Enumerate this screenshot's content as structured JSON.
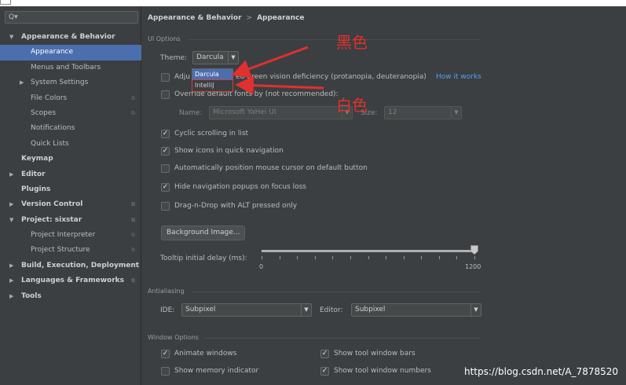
{
  "sidebar": {
    "search_placeholder": "Q▾",
    "items": [
      {
        "label": "Appearance & Behavior",
        "level": 0,
        "bold": true,
        "arrow": "▼"
      },
      {
        "label": "Appearance",
        "level": 1,
        "selected": true
      },
      {
        "label": "Menus and Toolbars",
        "level": 1
      },
      {
        "label": "System Settings",
        "level": 1,
        "arrow": "▶"
      },
      {
        "label": "File Colors",
        "level": 1,
        "copy": true
      },
      {
        "label": "Scopes",
        "level": 1,
        "copy": true
      },
      {
        "label": "Notifications",
        "level": 1
      },
      {
        "label": "Quick Lists",
        "level": 1
      },
      {
        "label": "Keymap",
        "level": 0,
        "bold": true
      },
      {
        "label": "Editor",
        "level": 0,
        "bold": true,
        "arrow": "▶"
      },
      {
        "label": "Plugins",
        "level": 0,
        "bold": true
      },
      {
        "label": "Version Control",
        "level": 0,
        "bold": true,
        "arrow": "▶",
        "copy": true
      },
      {
        "label": "Project: sixstar",
        "level": 0,
        "bold": true,
        "arrow": "▼",
        "copy": true
      },
      {
        "label": "Project Interpreter",
        "level": 1,
        "copy": true
      },
      {
        "label": "Project Structure",
        "level": 1,
        "copy": true
      },
      {
        "label": "Build, Execution, Deployment",
        "level": 0,
        "bold": true,
        "arrow": "▶"
      },
      {
        "label": "Languages & Frameworks",
        "level": 0,
        "bold": true,
        "arrow": "▶",
        "copy": true
      },
      {
        "label": "Tools",
        "level": 0,
        "bold": true,
        "arrow": "▶"
      }
    ]
  },
  "breadcrumb": {
    "part1": "Appearance & Behavior",
    "separator": ">",
    "part2": "Appearance"
  },
  "ui_options": {
    "title": "UI Options",
    "theme_label": "Theme:",
    "theme_value": "Darcula",
    "theme_options": [
      "Darcula",
      "IntelliJ"
    ],
    "adjust_label": "Adju",
    "adjust_rest": "ed-green vision deficiency (protanopia, deuteranopia)",
    "how_it_works": "How it works",
    "override_label": "Override default fonts by (not recommended):",
    "name_label": "Name:",
    "name_value": "Microsoft YaHei UI",
    "size_label": "Size:",
    "size_value": "12",
    "checkboxes": [
      {
        "label": "Cyclic scrolling in list",
        "checked": true
      },
      {
        "label": "Show icons in quick navigation",
        "checked": true
      },
      {
        "label": "Automatically position mouse cursor on default button",
        "checked": false
      },
      {
        "label": "Hide navigation popups on focus loss",
        "checked": true
      },
      {
        "label": "Drag-n-Drop with ALT pressed only",
        "checked": false
      }
    ],
    "background_button": "Background Image...",
    "tooltip_label": "Tooltip initial delay (ms):",
    "slider_min": "0",
    "slider_max": "1200",
    "slider_value_fraction": 1.0
  },
  "antialiasing": {
    "title": "Antialiasing",
    "ide_label": "IDE:",
    "ide_value": "Subpixel",
    "editor_label": "Editor:",
    "editor_value": "Subpixel"
  },
  "window_options": {
    "title": "Window Options",
    "checkboxes": [
      {
        "label": "Animate windows",
        "checked": true
      },
      {
        "label": "Show tool window bars",
        "checked": true
      },
      {
        "label": "Show memory indicator",
        "checked": false
      },
      {
        "label": "Show tool window numbers",
        "checked": true
      }
    ]
  },
  "annotations": {
    "black_note": "黑色",
    "white_note": "白色"
  },
  "watermark": "https://blog.csdn.net/A_7878520",
  "colors": {
    "background": "#3c3f41",
    "selection": "#4b6eaf",
    "link": "#589df6",
    "annotation": "#e03030"
  }
}
